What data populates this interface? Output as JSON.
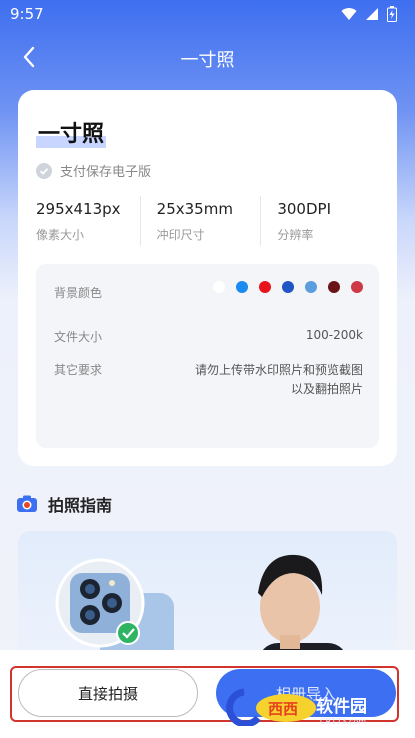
{
  "status": {
    "time": "9:57"
  },
  "header": {
    "title": "一寸照"
  },
  "spec": {
    "name": "一寸照",
    "paid_label": "支付保存电子版",
    "stats": [
      {
        "value": "295x413px",
        "label": "像素大小"
      },
      {
        "value": "25x35mm",
        "label": "冲印尺寸"
      },
      {
        "value": "300DPI",
        "label": "分辨率"
      }
    ],
    "bg_color_label": "背景颜色",
    "bg_colors": [
      "#ffffff",
      "#1a8bf0",
      "#e8141b",
      "#1f55c4",
      "#5a9ee0",
      "#6a1418",
      "#cf3846"
    ],
    "file_size_label": "文件大小",
    "file_size_value": "100-200k",
    "other_label": "其它要求",
    "other_value_line1": "请勿上传带水印照片和预览截图",
    "other_value_line2": "以及翻拍照片"
  },
  "guide": {
    "title": "拍照指南"
  },
  "actions": {
    "shoot_label": "直接拍摄",
    "import_label": "相册导入"
  },
  "watermark": {
    "text": "软件园",
    "sub": "CR173.com"
  },
  "colors": {
    "accent": "#3c6ff2",
    "highlight": "#d0342c"
  }
}
